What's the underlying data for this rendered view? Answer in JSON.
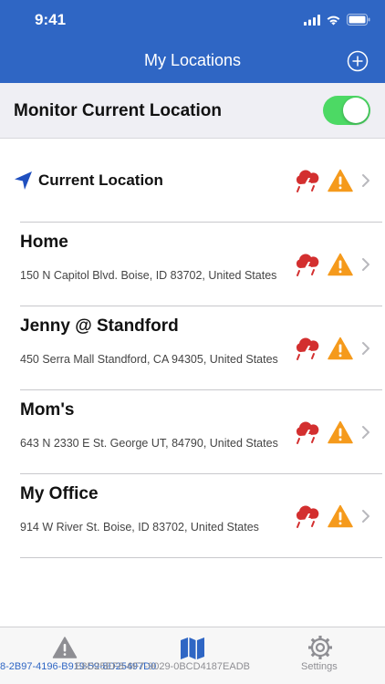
{
  "status_bar": {
    "time": "9:41"
  },
  "nav": {
    "title": "My Locations",
    "add_icon": "plus-circle-icon"
  },
  "monitor": {
    "label": "Monitor Current Location",
    "enabled": true
  },
  "colors": {
    "header": "#2f66c4",
    "toggle_on": "#4cd964",
    "warning": "#f59a1c",
    "storm": "#d32f2f",
    "current_location_arrow": "#1f4fbf"
  },
  "current_location": {
    "label": "Current Location",
    "icons": [
      "location-arrow-icon",
      "storm-icon",
      "warning-icon",
      "chevron-right-icon"
    ]
  },
  "locations": [
    {
      "name": "Home",
      "address": "150 N Capitol Blvd. Boise, ID 83702, United States"
    },
    {
      "name": "Jenny @ Standford",
      "address": "450 Serra Mall Standford, CA 94305, United States"
    },
    {
      "name": "Mom's",
      "address": "643 N 2330 E St. George UT, 84790, United States"
    },
    {
      "name": "My Office",
      "address": "914 W River St. Boise, ID 83702, United States"
    }
  ],
  "tabs": [
    {
      "label": "8-2B97-4196-B919-59-8D25497D0",
      "icon": "warning-triangle-icon"
    },
    {
      "label": "E8D25EF8-6F7-9029-0BCD4187EADB",
      "icon": "map-icon"
    },
    {
      "label": "Settings",
      "icon": "gear-icon"
    }
  ]
}
